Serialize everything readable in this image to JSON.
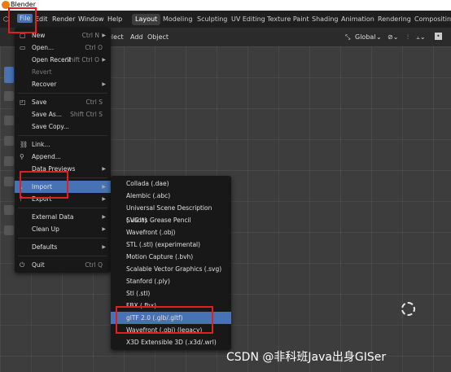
{
  "app_title": "Blender",
  "menubar": {
    "items": [
      "File",
      "Edit",
      "Render",
      "Window",
      "Help"
    ],
    "workspaces": [
      "Layout",
      "Modeling",
      "Sculpting",
      "UV Editing",
      "Texture Paint",
      "Shading",
      "Animation",
      "Rendering",
      "Compositing"
    ],
    "active_workspace": "Layout"
  },
  "header": {
    "select_fragment": "elect",
    "add": "Add",
    "object": "Object",
    "transform": "Global"
  },
  "file_menu": [
    {
      "label": "New",
      "shortcut": "Ctrl N",
      "icon": "new-file-icon",
      "submenu": true
    },
    {
      "label": "Open...",
      "shortcut": "Ctrl O",
      "icon": "folder-icon"
    },
    {
      "label": "Open Recent",
      "shortcut": "Shift Ctrl O",
      "submenu": true
    },
    {
      "label": "Revert",
      "disabled": true
    },
    {
      "label": "Recover",
      "submenu": true
    },
    {
      "sep": true
    },
    {
      "label": "Save",
      "shortcut": "Ctrl S",
      "icon": "save-icon"
    },
    {
      "label": "Save As...",
      "shortcut": "Shift Ctrl S"
    },
    {
      "label": "Save Copy..."
    },
    {
      "sep": true
    },
    {
      "label": "Link...",
      "icon": "link-icon"
    },
    {
      "label": "Append...",
      "icon": "append-icon"
    },
    {
      "label": "Data Previews",
      "submenu": true
    },
    {
      "sep": true
    },
    {
      "label": "Import",
      "icon": "import-icon",
      "submenu": true,
      "highlighted": true
    },
    {
      "label": "Export",
      "icon": "export-icon",
      "submenu": true
    },
    {
      "sep": true
    },
    {
      "label": "External Data",
      "submenu": true
    },
    {
      "label": "Clean Up",
      "submenu": true
    },
    {
      "sep": true
    },
    {
      "label": "Defaults",
      "submenu": true
    },
    {
      "sep": true
    },
    {
      "label": "Quit",
      "shortcut": "Ctrl Q",
      "icon": "power-icon"
    }
  ],
  "import_menu": [
    {
      "label": "Collada (.dae)"
    },
    {
      "label": "Alembic (.abc)"
    },
    {
      "label": "Universal Scene Description (.usd*)"
    },
    {
      "label": "SVG as Grease Pencil"
    },
    {
      "label": "Wavefront (.obj)"
    },
    {
      "label": "STL (.stl) (experimental)"
    },
    {
      "label": "Motion Capture (.bvh)"
    },
    {
      "label": "Scalable Vector Graphics (.svg)"
    },
    {
      "label": "Stanford (.ply)"
    },
    {
      "label": "Stl (.stl)"
    },
    {
      "label": "FBX (.fbx)"
    },
    {
      "label": "glTF 2.0 (.glb/.gltf)",
      "highlighted": true
    },
    {
      "label": "Wavefront (.obj) (legacy)"
    },
    {
      "label": "X3D Extensible 3D (.x3d/.wrl)"
    }
  ],
  "watermark": "CSDN @非科班Java出身GISer",
  "colors": {
    "highlight": "#4772b3",
    "annotation": "#e02020"
  }
}
